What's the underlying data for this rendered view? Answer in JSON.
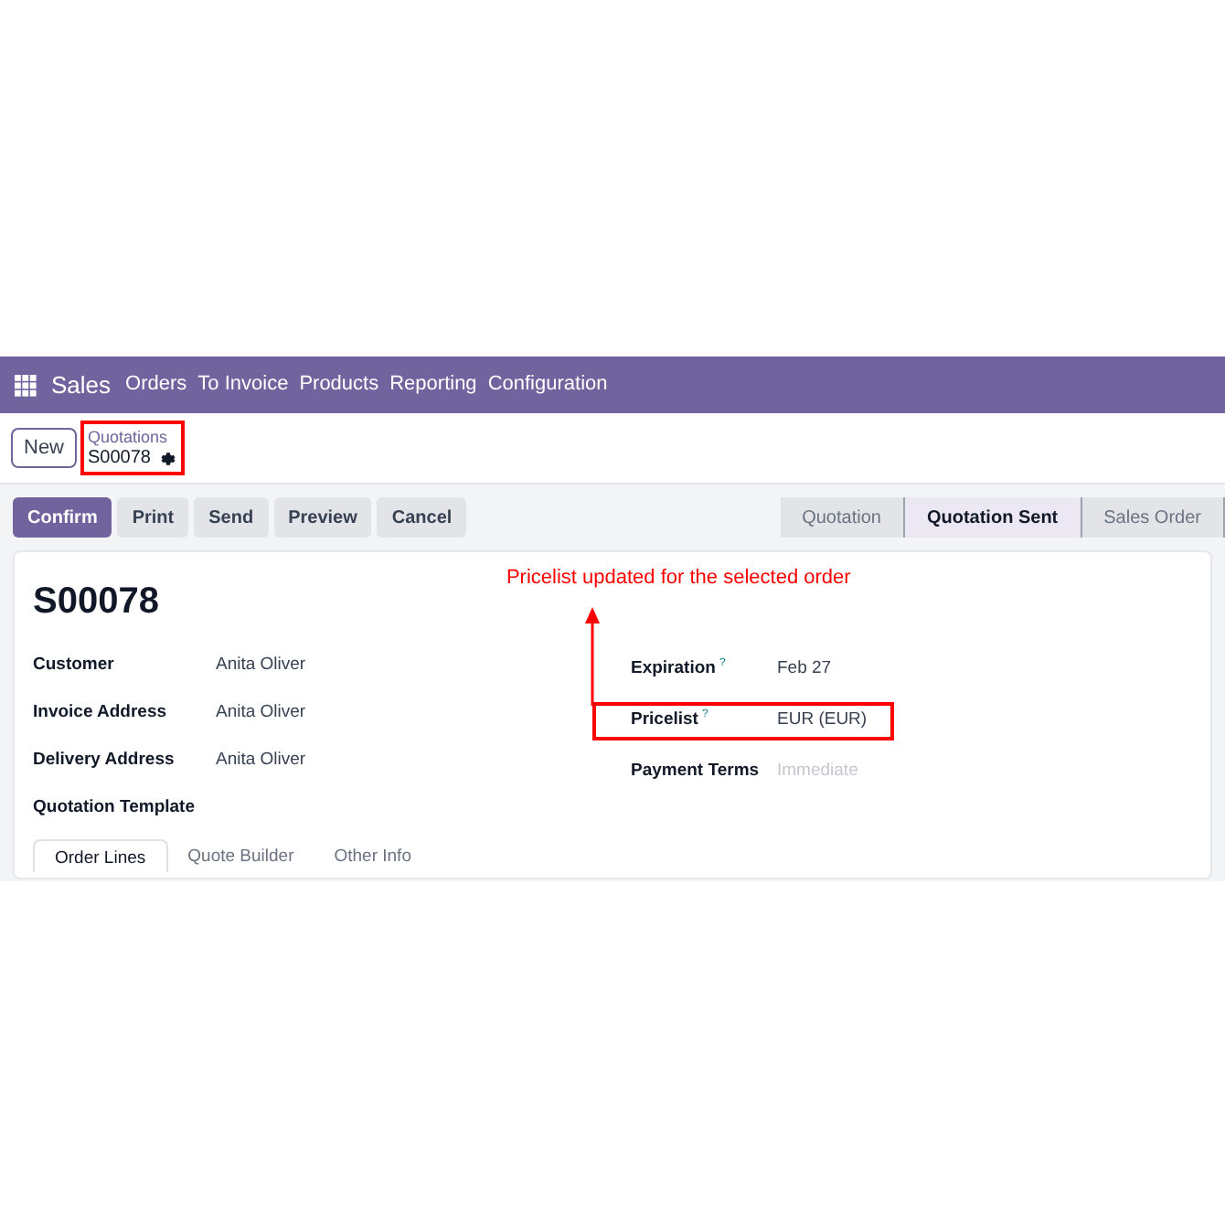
{
  "navbar": {
    "app": "Sales",
    "menu": [
      "Orders",
      "To Invoice",
      "Products",
      "Reporting",
      "Configuration"
    ]
  },
  "control_panel": {
    "new_button": "New",
    "breadcrumb": "Quotations",
    "record": "S00078",
    "highlighted": true
  },
  "actions": [
    {
      "label": "Confirm",
      "primary": true
    },
    {
      "label": "Print",
      "primary": false
    },
    {
      "label": "Send",
      "primary": false
    },
    {
      "label": "Preview",
      "primary": false
    },
    {
      "label": "Cancel",
      "primary": false
    }
  ],
  "status": [
    {
      "label": "Quotation",
      "selected": false
    },
    {
      "label": "Quotation Sent",
      "selected": true
    },
    {
      "label": "Sales Order",
      "selected": false
    }
  ],
  "form": {
    "title": "S00078",
    "left_fields": [
      {
        "label": "Customer",
        "value": "Anita Oliver"
      },
      {
        "label": "Invoice Address",
        "value": "Anita Oliver"
      },
      {
        "label": "Delivery Address",
        "value": "Anita Oliver"
      },
      {
        "label": "Quotation Template"
      }
    ],
    "right_fields": [
      {
        "label": "Expiration",
        "help": "?",
        "value": "Feb 27",
        "highlighted": false
      },
      {
        "label": "Pricelist",
        "help": "?",
        "value": "EUR (EUR)",
        "highlighted": true
      },
      {
        "label": "Payment Terms",
        "placeholder": "Immediate",
        "highlighted": false
      }
    ],
    "tabs": [
      {
        "label": "Order Lines",
        "selected": true
      },
      {
        "label": "Quote Builder",
        "selected": false
      },
      {
        "label": "Other Info",
        "selected": false
      }
    ]
  },
  "annotation": {
    "text": "Pricelist updated for the selected order"
  }
}
